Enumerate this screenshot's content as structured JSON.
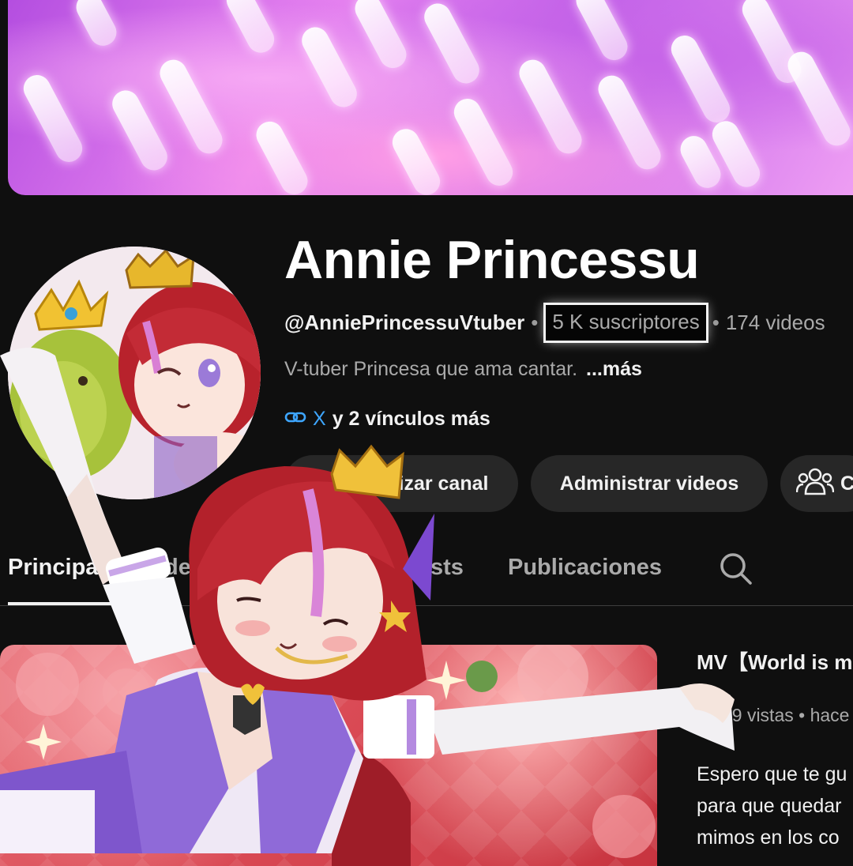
{
  "channel": {
    "name": "Annie Princessu",
    "handle": "@AnniePrincessuVtuber",
    "separator": "•",
    "subscribers": "5 K suscriptores",
    "videos": "174 videos",
    "description": "V-tuber Princesa que ama cantar.",
    "more_label": "...más",
    "link_x": "X",
    "links_more": "y 2 vínculos más"
  },
  "buttons": {
    "customize": "lizar canal",
    "manage": "Administrar videos",
    "third": "C"
  },
  "tabs": [
    {
      "label": "Principal"
    },
    {
      "label": "ide"
    },
    {
      "label": "sts"
    },
    {
      "label": "Publicaciones"
    }
  ],
  "featured_video": {
    "title": "MV【World is m",
    "meta": "1,569 vistas • hace",
    "description_lines": [
      "Espero que te gu",
      "para que quedar",
      "mimos en los co"
    ]
  },
  "colors": {
    "background": "#0f0f0f",
    "button_bg": "#272727",
    "link_blue": "#3ea6ff",
    "secondary_text": "#aaaaaa"
  },
  "icons": [
    "link-icon",
    "people-icon",
    "search-icon"
  ]
}
